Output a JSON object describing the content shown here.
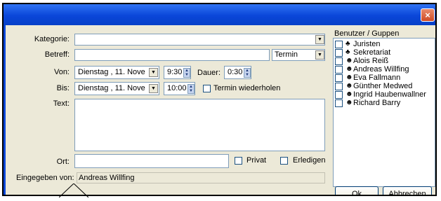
{
  "dialog": {
    "close_label": "×"
  },
  "form": {
    "kategorie_label": "Kategorie:",
    "kategorie_value": "",
    "betreff_label": "Betreff:",
    "betreff_value": "",
    "betreff_type": "Termin",
    "von_label": "Von:",
    "von_date": "Dienstag , 11. Nove",
    "von_time": "9:30",
    "dauer_label": "Dauer:",
    "dauer_value": "0:30",
    "bis_label": "Bis:",
    "bis_date": "Dienstag , 11. Nove",
    "bis_time": "10:00",
    "repeat_label": "Termin wiederholen",
    "text_label": "Text:",
    "text_value": "",
    "ort_label": "Ort:",
    "ort_value": "",
    "privat_label": "Privat",
    "erledigen_label": "Erledigen",
    "eingegeben_label": "Eingegeben von:",
    "eingegeben_value": "Andreas Willfing"
  },
  "users": {
    "header": "Benutzer / Guppen",
    "items": [
      {
        "name": "Juristen",
        "icon": "group-icon"
      },
      {
        "name": "Sekretariat",
        "icon": "group-icon"
      },
      {
        "name": "Alois Reiß",
        "icon": "user-icon"
      },
      {
        "name": "Andreas Willfing",
        "icon": "user-icon"
      },
      {
        "name": "Eva Fallmann",
        "icon": "user-icon"
      },
      {
        "name": "Günther Medwed",
        "icon": "user-icon"
      },
      {
        "name": "Ingrid Haubenwallner",
        "icon": "user-icon"
      },
      {
        "name": "Richard Barry",
        "icon": "user-icon"
      }
    ]
  },
  "buttons": {
    "ok": "Ok",
    "cancel": "Abbrechen"
  }
}
